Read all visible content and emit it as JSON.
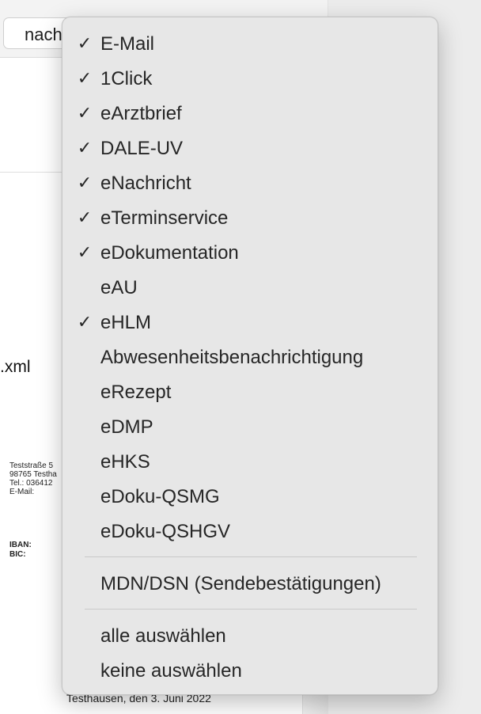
{
  "toolbar": {
    "button_label": "nach"
  },
  "document": {
    "filename_fragment": ".xml",
    "address_lines": [
      "Teststraße 5",
      "98765 Testha",
      "Tel.: 036412",
      "E-Mail:"
    ],
    "bank_lines": [
      "IBAN:",
      "BIC:"
    ],
    "date_line": "Testhausen, den 3. Juni 2022"
  },
  "menu": {
    "check_glyph": "✓",
    "items": [
      {
        "label": "E-Mail",
        "checked": true
      },
      {
        "label": "1Click",
        "checked": true
      },
      {
        "label": "eArztbrief",
        "checked": true
      },
      {
        "label": "DALE-UV",
        "checked": true
      },
      {
        "label": "eNachricht",
        "checked": true
      },
      {
        "label": "eTerminservice",
        "checked": true
      },
      {
        "label": "eDokumentation",
        "checked": true
      },
      {
        "label": "eAU",
        "checked": false
      },
      {
        "label": "eHLM",
        "checked": true
      },
      {
        "label": "Abwesenheitsbenachrichtigung",
        "checked": false
      },
      {
        "label": "eRezept",
        "checked": false
      },
      {
        "label": "eDMP",
        "checked": false
      },
      {
        "label": "eHKS",
        "checked": false
      },
      {
        "label": "eDoku-QSMG",
        "checked": false
      },
      {
        "label": "eDoku-QSHGV",
        "checked": false
      }
    ],
    "mdn_label": "MDN/DSN (Sendebestätigungen)",
    "select_all_label": "alle auswählen",
    "select_none_label": "keine auswählen"
  }
}
